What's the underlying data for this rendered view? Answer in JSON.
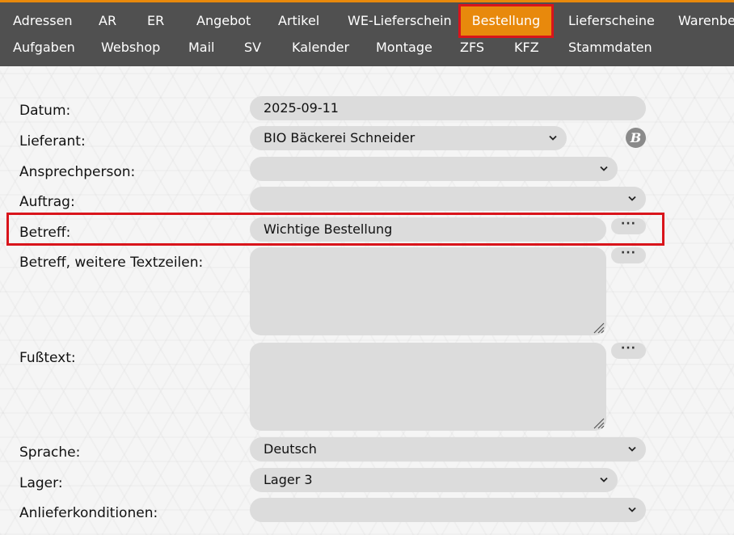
{
  "nav": {
    "row1": [
      "Adressen",
      "AR",
      "ER",
      "Angebot",
      "Artikel",
      "WE-Lieferschein",
      "Bestellung",
      "Lieferscheine",
      "Warenbew"
    ],
    "row2": [
      "Aufgaben",
      "Webshop",
      "Mail",
      "SV",
      "Kalender",
      "Montage",
      "ZFS",
      "KFZ",
      "Stammdaten"
    ],
    "active": "Bestellung"
  },
  "form": {
    "datum": {
      "label": "Datum:",
      "value": "2025-09-11"
    },
    "lieferant": {
      "label": "Lieferant:",
      "value": "BIO Bäckerei Schneider",
      "icon_text": "B"
    },
    "ansprechperson": {
      "label": "Ansprechperson:",
      "value": ""
    },
    "auftrag": {
      "label": "Auftrag:",
      "value": ""
    },
    "betreff": {
      "label": "Betreff:",
      "value": "Wichtige Bestellung"
    },
    "betreff_weitere": {
      "label": "Betreff, weitere Textzeilen:",
      "value": ""
    },
    "fusstext": {
      "label": "Fußtext:",
      "value": ""
    },
    "sprache": {
      "label": "Sprache:",
      "value": "Deutsch"
    },
    "lager": {
      "label": "Lager:",
      "value": "Lager 3"
    },
    "anlieferkonditionen": {
      "label": "Anlieferkonditionen:",
      "value": ""
    },
    "dots_label": "···"
  },
  "colors": {
    "nav_bg": "#505050",
    "accent": "#e8890c",
    "highlight": "#d9141b",
    "field_bg": "#dcdcdc"
  }
}
